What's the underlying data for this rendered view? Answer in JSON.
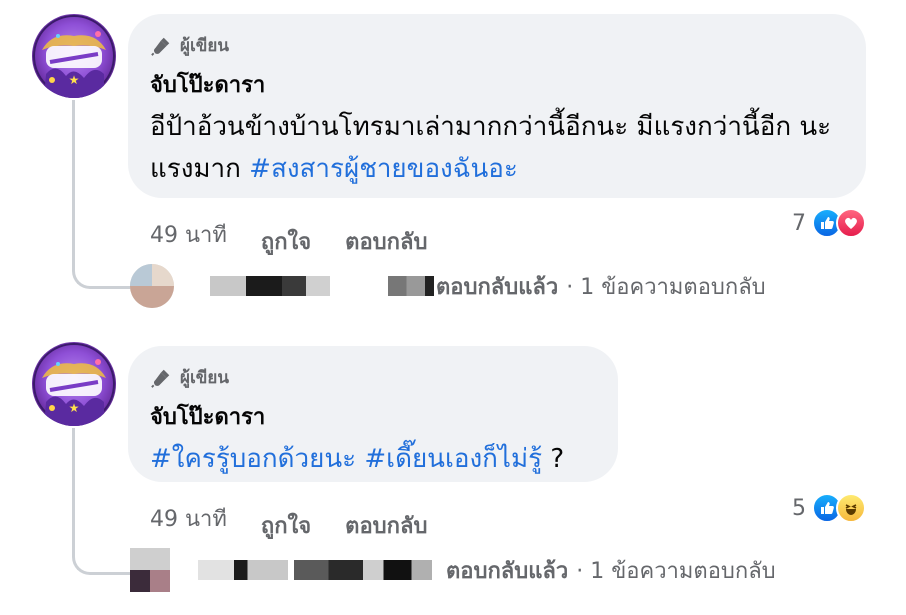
{
  "comments": [
    {
      "badge": "ผู้เขียน",
      "author": "จับโป๊ะดารา",
      "text_plain": "อีป้าอ้วนข้างบ้านโทรมาเล่ามากกว่านี้อีกนะ มีแรงกว่านี้อีก นะ แรงมาก ",
      "hashtags": [
        "#สงสารผู้ชายของฉันอะ"
      ],
      "time": "49 นาที",
      "like_label": "ถูกใจ",
      "reply_label": "ตอบกลับ",
      "reaction_count": "7",
      "reactions": [
        "like-icon",
        "love-icon"
      ],
      "replied_label": "ตอบกลับแล้ว",
      "reply_summary": "· 1 ข้อความตอบกลับ"
    },
    {
      "badge": "ผู้เขียน",
      "author": "จับโป๊ะดารา",
      "hashtags": [
        "#ใครรู้บอกด้วยนะ",
        "#เดี๊ยนเองก็ไม่รู้"
      ],
      "text_suffix": " ?",
      "time": "49 นาที",
      "like_label": "ถูกใจ",
      "reply_label": "ตอบกลับ",
      "reaction_count": "5",
      "reactions": [
        "like-icon",
        "haha-icon"
      ],
      "replied_label": "ตอบกลับแล้ว",
      "reply_summary": "· 1 ข้อความตอบกลับ"
    }
  ],
  "colors": {
    "hashtag": "#216fdb",
    "bubble": "#f0f2f5",
    "meta": "#65676b"
  }
}
